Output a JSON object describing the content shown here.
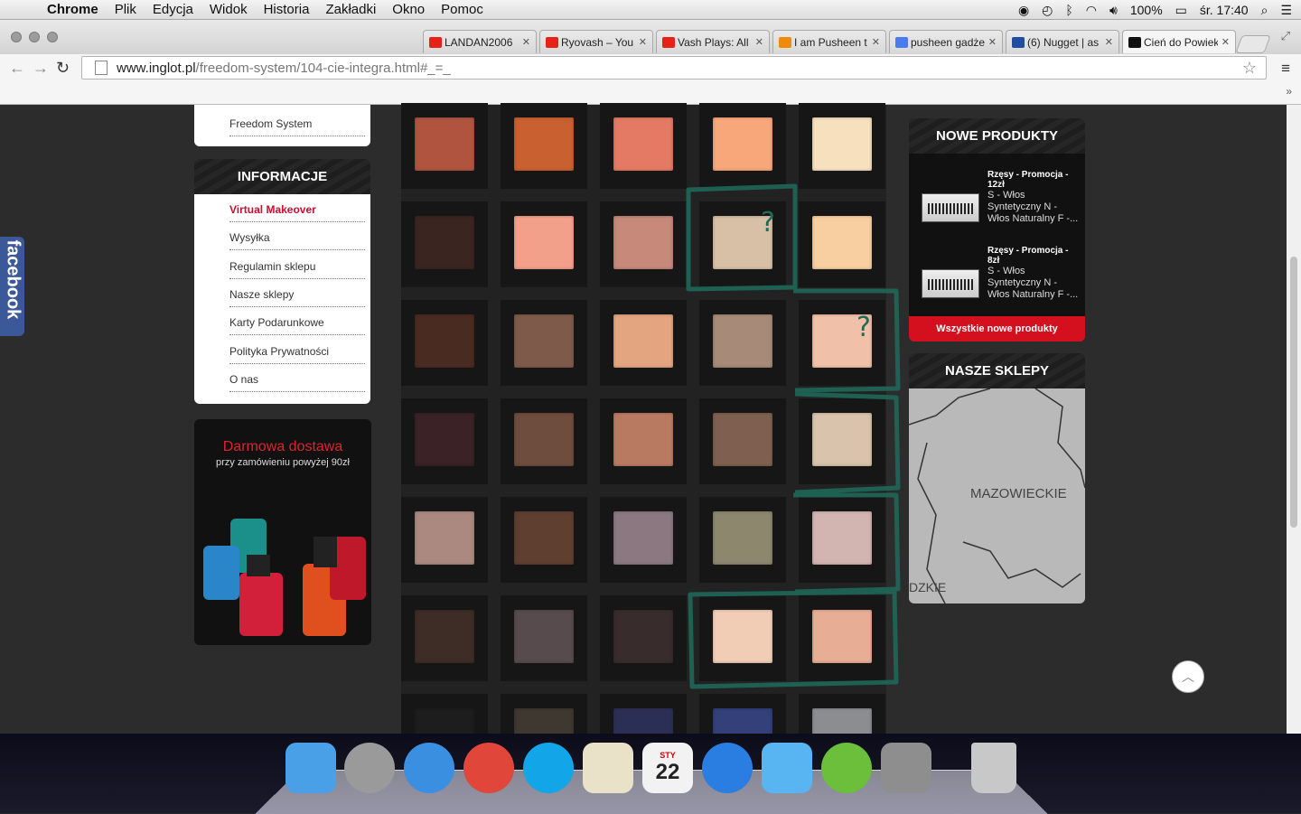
{
  "menubar": {
    "app": "Chrome",
    "items": [
      "Plik",
      "Edycja",
      "Widok",
      "Historia",
      "Zakładki",
      "Okno",
      "Pomoc"
    ],
    "battery": "100%",
    "clock": "śr. 17:40"
  },
  "tabs": [
    {
      "title": "LANDAN2006",
      "favicon": "youtube-icon",
      "color": "#e62117"
    },
    {
      "title": "Ryovash – You",
      "favicon": "youtube-icon",
      "color": "#e62117"
    },
    {
      "title": "Vash Plays: All",
      "favicon": "youtube-icon",
      "color": "#e62117"
    },
    {
      "title": "I am Pusheen t",
      "favicon": "amazon-icon",
      "color": "#f08a0b"
    },
    {
      "title": "pusheen gadże",
      "favicon": "google-icon",
      "color": "#4a7af0"
    },
    {
      "title": "(6) Nugget | as",
      "favicon": "ask-icon",
      "color": "#1f4ea1"
    },
    {
      "title": "Cień do Powiek",
      "favicon": "inglot-icon",
      "color": "#111111"
    }
  ],
  "omnibox": {
    "host": "www.inglot.pl",
    "path": "/freedom-system/104-cie-integra.html#_=_"
  },
  "facebook_tab": "facebook",
  "left_sidebar": {
    "top_item": "Freedom System",
    "info_heading": "INFORMACJE",
    "items": [
      {
        "label": "Virtual Makeover",
        "active": true
      },
      {
        "label": "Wysyłka"
      },
      {
        "label": "Regulamin sklepu"
      },
      {
        "label": "Nasze sklepy"
      },
      {
        "label": "Karty Podarunkowe"
      },
      {
        "label": "Polityka Prywatności"
      },
      {
        "label": "O nas"
      }
    ],
    "promo": {
      "title": "Darmowa dostawa",
      "subtitle": "przy zamówieniu powyżej 90zł"
    }
  },
  "palette": {
    "rows": [
      [
        "#b0543f",
        "#c9602f",
        "#e47a63",
        "#f7a77a",
        "#f6e0be"
      ],
      [
        "#3b2520",
        "#f2a089",
        "#c6897a",
        "#d8c0a6",
        "#f8cfa1"
      ],
      [
        "#4a2b22",
        "#7e5a4b",
        "#e3a57f",
        "#a78a78",
        "#f0c1a8"
      ],
      [
        "#3a2226",
        "#6e4c3e",
        "#b97a62",
        "#7f6050",
        "#d9c3ad"
      ],
      [
        "#ab8981",
        "#5e3f30",
        "#8b7880",
        "#8d876e",
        "#d2b5b1"
      ],
      [
        "#3e2c26",
        "#574b4d",
        "#392c2c",
        "#f1cdb6",
        "#e8ae95"
      ],
      [
        "#1d1d1d",
        "#3e3830",
        "#2c2f55",
        "#33407a",
        "#8c8d90"
      ]
    ],
    "annotation_color": "#1e6b5a",
    "annotations": [
      "?",
      "?"
    ]
  },
  "right_sidebar": {
    "new_heading": "NOWE PRODUKTY",
    "products": [
      {
        "title": "Rzęsy - Promocja - 12zł",
        "desc": "S - Włos Syntetyczny N - Włos Naturalny F -..."
      },
      {
        "title": "Rzęsy - Promocja - 8zł",
        "desc": "S - Włos Syntetyczny N - Włos Naturalny F -..."
      }
    ],
    "all_new": "Wszystkie nowe produkty",
    "stores_heading": "NASZE SKLEPY",
    "map_label": "MAZOWIECKIE",
    "map_label2": "DZKIE"
  },
  "dock": {
    "calendar_month": "STY",
    "calendar_day": "22",
    "apps": [
      {
        "name": "finder-icon",
        "color": "#4aa0e6"
      },
      {
        "name": "launchpad-icon",
        "color": "#9a9a9a"
      },
      {
        "name": "itunes-icon",
        "color": "#3b8fe0"
      },
      {
        "name": "chrome-icon",
        "color": "#e0463a"
      },
      {
        "name": "skype-icon",
        "color": "#12a5e8"
      },
      {
        "name": "textedit-icon",
        "color": "#e9e2c8"
      },
      {
        "name": "calendar-icon",
        "color": "#f2f2f2"
      },
      {
        "name": "app-store-icon",
        "color": "#2a7de1"
      },
      {
        "name": "messages-icon",
        "color": "#58b5f2"
      },
      {
        "name": "utorrent-icon",
        "color": "#6cbf3a"
      },
      {
        "name": "system-preferences-icon",
        "color": "#8e8e8e"
      },
      {
        "name": "trash-icon",
        "color": "#c8c8c8"
      }
    ]
  }
}
